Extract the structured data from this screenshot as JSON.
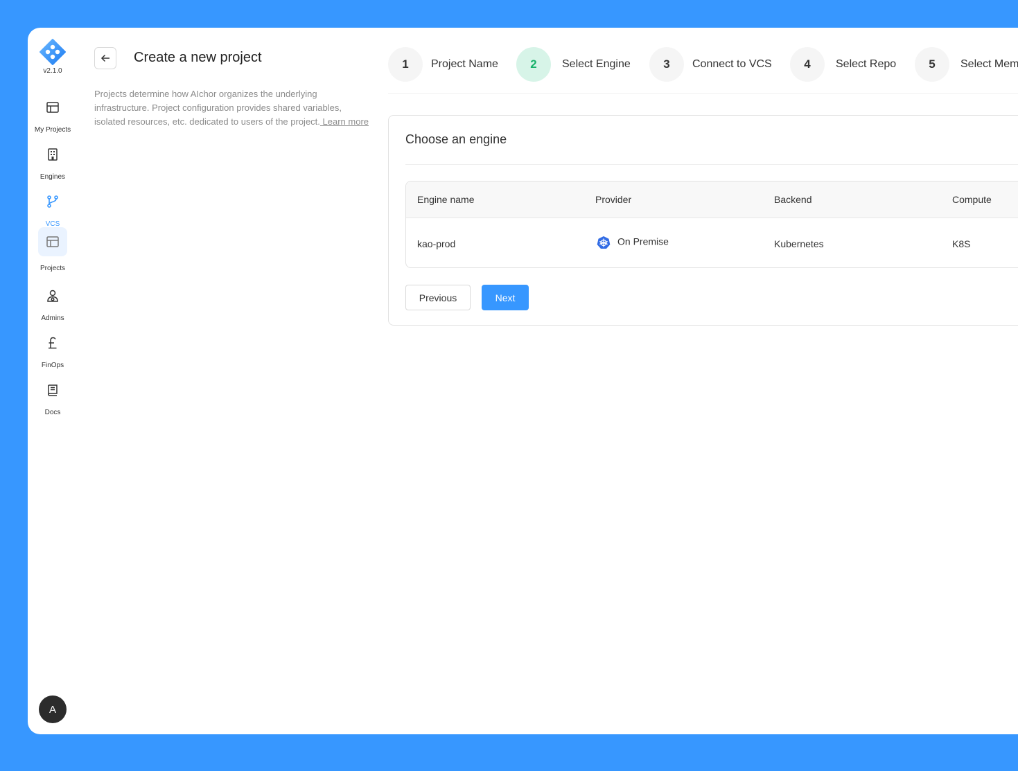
{
  "app": {
    "version": "v2.1.0"
  },
  "sidebar": {
    "items": [
      {
        "label": "My Projects",
        "icon": "layout-icon"
      },
      {
        "label": "Engines",
        "icon": "building-icon"
      },
      {
        "label": "VCS",
        "icon": "branch-icon"
      },
      {
        "label": "Projects",
        "icon": "layout-icon"
      },
      {
        "label": "Admins",
        "icon": "admin-icon"
      },
      {
        "label": "FinOps",
        "icon": "pound-icon"
      },
      {
        "label": "Docs",
        "icon": "book-icon"
      }
    ],
    "avatar_initial": "A"
  },
  "header": {
    "title": "Create a new project",
    "description": "Projects determine how AIchor organizes the underlying infrastructure.  Project configuration provides shared variables, isolated resources,  etc. dedicated to users of the project.",
    "learn_more": " Learn more"
  },
  "stepper": {
    "steps": [
      {
        "number": "1",
        "label": "Project Name"
      },
      {
        "number": "2",
        "label": "Select Engine"
      },
      {
        "number": "3",
        "label": "Connect to VCS"
      },
      {
        "number": "4",
        "label": "Select Repo"
      },
      {
        "number": "5",
        "label": "Select Members"
      }
    ],
    "current": "2"
  },
  "card": {
    "title": "Choose an engine",
    "table": {
      "columns": [
        "Engine name",
        "Provider",
        "Backend",
        "Compute"
      ],
      "rows": [
        {
          "engine_name": "kao-prod",
          "provider": "On Premise",
          "backend": "Kubernetes",
          "compute": "K8S"
        }
      ]
    },
    "previous_label": "Previous",
    "next_label": "Next"
  },
  "colors": {
    "accent": "#3797ff",
    "step_active_bg": "#d7f4e8",
    "step_active_text": "#18b26b"
  }
}
